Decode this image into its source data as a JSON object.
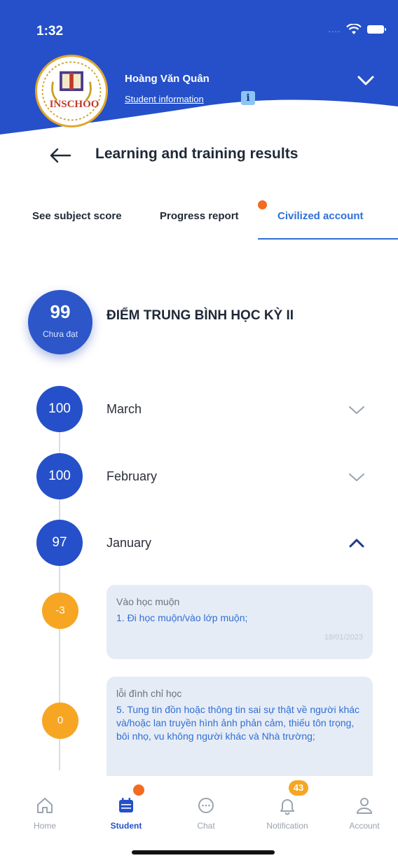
{
  "status_bar": {
    "time": "1:32",
    "signal": "....",
    "wifi_icon": "wifi-icon",
    "battery_icon": "battery-icon"
  },
  "header": {
    "bg_color": "#2550c9",
    "logo_text": "INSCHOO",
    "user_name": "Hoàng Văn Quân",
    "student_info_link": "Student information",
    "info_badge": "i"
  },
  "page": {
    "title": "Learning and training results"
  },
  "tabs": [
    {
      "label": "See subject score"
    },
    {
      "label": "Progress report"
    },
    {
      "label": "Civilized account"
    }
  ],
  "average": {
    "score": "99",
    "status": "Chưa đạt",
    "title": "ĐIỂM TRUNG BÌNH HỌC KỲ II"
  },
  "months": [
    {
      "score": "100",
      "label": "March"
    },
    {
      "score": "100",
      "label": "February"
    },
    {
      "score": "97",
      "label": "January"
    }
  ],
  "entries": [
    {
      "score": "-3",
      "title": "Vào học muộn",
      "desc": "1. Đi học muộn/vào lớp muộn;",
      "date": "18/01/2023"
    },
    {
      "score": "0",
      "title": "lỗi đình chỉ học",
      "desc": "5. Tung tin đồn hoặc thông tin sai sự thật về người khác và/hoặc lan truyền hình ảnh phản cảm, thiếu tôn trọng, bôi nhọ, vu không người khác và Nhà trường;",
      "date": ""
    }
  ],
  "bottom_nav": [
    {
      "label": "Home",
      "icon": "home-icon"
    },
    {
      "label": "Student",
      "icon": "calendar-icon"
    },
    {
      "label": "Chat",
      "icon": "chat-icon"
    },
    {
      "label": "Notification",
      "icon": "bell-icon",
      "badge": "43"
    },
    {
      "label": "Account",
      "icon": "user-icon"
    }
  ],
  "colors": {
    "primary": "#2550c9",
    "accent": "#2f6fd6",
    "orange": "#f6a623",
    "dot": "#f26b21"
  }
}
